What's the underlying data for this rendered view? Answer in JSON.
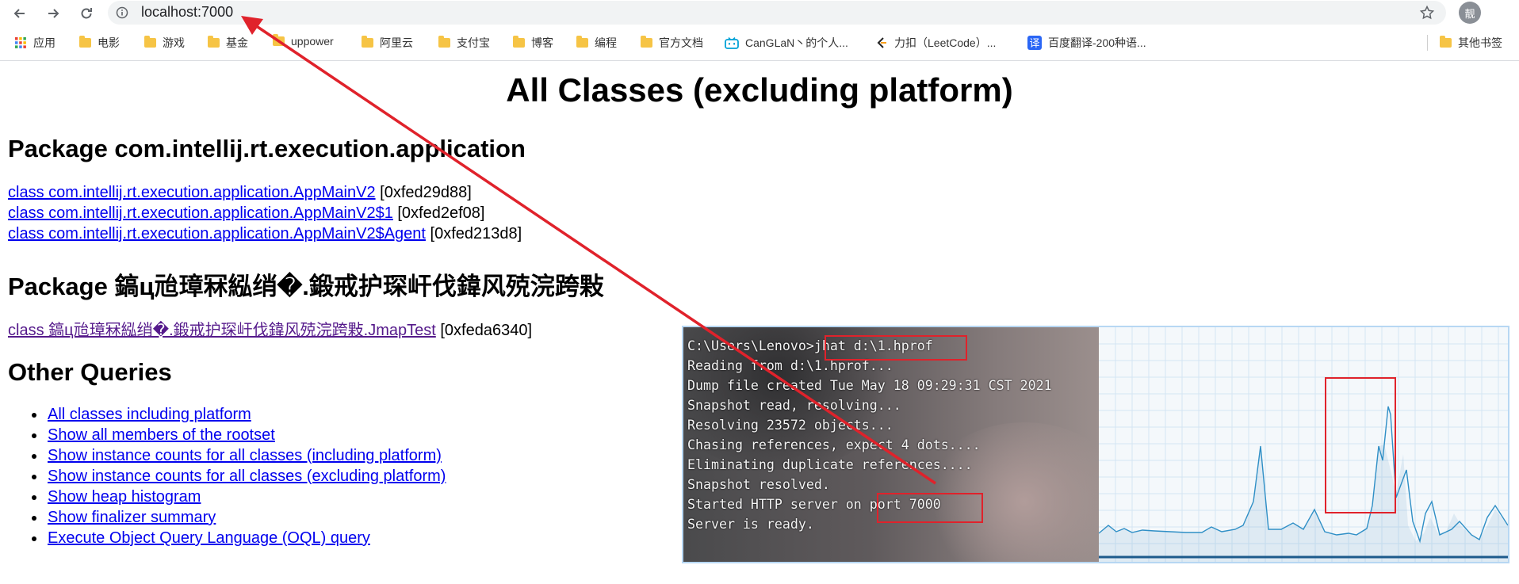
{
  "browser": {
    "url": "localhost:7000",
    "profile_initial": "靓",
    "bookmarks": [
      {
        "label": "应用",
        "icon": "apps-grid-icon"
      },
      {
        "label": "电影",
        "icon": "folder-icon"
      },
      {
        "label": "游戏",
        "icon": "folder-icon"
      },
      {
        "label": "基金",
        "icon": "folder-icon"
      },
      {
        "label": "uppower",
        "icon": "folder-icon"
      },
      {
        "label": "阿里云",
        "icon": "folder-icon"
      },
      {
        "label": "支付宝",
        "icon": "folder-icon"
      },
      {
        "label": "博客",
        "icon": "folder-icon"
      },
      {
        "label": "编程",
        "icon": "folder-icon"
      },
      {
        "label": "官方文档",
        "icon": "folder-icon"
      },
      {
        "label": "CanGLaN丶的个人...",
        "icon": "bilibili-icon"
      },
      {
        "label": "力扣（LeetCode）...",
        "icon": "leetcode-icon"
      },
      {
        "label": "百度翻译-200种语...",
        "icon": "translate-icon"
      },
      {
        "label": "其他书签",
        "icon": "folder-icon"
      }
    ]
  },
  "page": {
    "title": "All Classes (excluding platform)",
    "package1": {
      "heading": "Package com.intellij.rt.execution.application",
      "classes": [
        {
          "link": "class com.intellij.rt.execution.application.AppMainV2",
          "addr": " [0xfed29d88]"
        },
        {
          "link": "class com.intellij.rt.execution.application.AppMainV2$1",
          "addr": " [0xfed2ef08]"
        },
        {
          "link": "class com.intellij.rt.execution.application.AppMainV2$Agent",
          "addr": " [0xfed213d8]"
        }
      ]
    },
    "package2": {
      "heading": "Package 鎬ц兘璋冧紭绡�.鍛戒护琛屽伐鍏风殑浣跨敤",
      "classes": [
        {
          "link": "class 鎬ц兘璋冧紭绡�.鍛戒护琛屽伐鍏风殑浣跨敤.JmapTest",
          "addr": " [0xfeda6340]"
        }
      ]
    },
    "other_queries": {
      "heading": "Other Queries",
      "links": [
        "All classes including platform",
        "Show all members of the rootset",
        "Show instance counts for all classes (including platform)",
        "Show instance counts for all classes (excluding platform)",
        "Show heap histogram",
        "Show finalizer summary",
        "Execute Object Query Language (OQL) query"
      ]
    }
  },
  "terminal": {
    "lines": [
      "C:\\Users\\Lenovo>jhat d:\\1.hprof",
      "Reading from d:\\1.hprof...",
      "Dump file created Tue May 18 09:29:31 CST 2021",
      "Snapshot read, resolving...",
      "Resolving 23572 objects...",
      "Chasing references, expect 4 dots....",
      "Eliminating duplicate references....",
      "Snapshot resolved.",
      "Started HTTP server on port 7000",
      "Server is ready."
    ]
  },
  "annotation_color": "#e0222b",
  "link_color": "#0000ee",
  "visited_link_color": "#551a8b"
}
